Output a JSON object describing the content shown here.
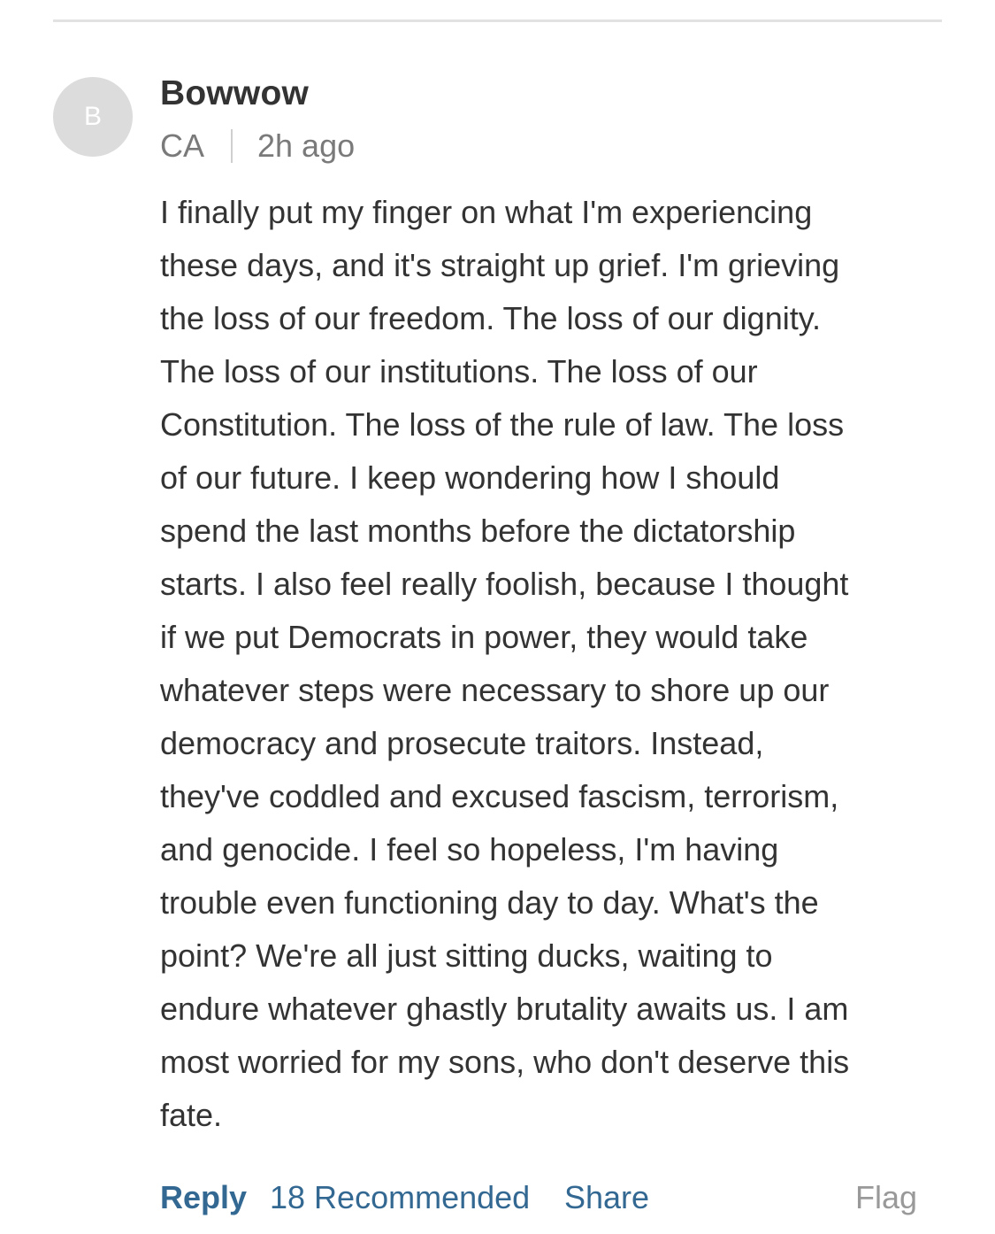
{
  "comment": {
    "avatar_initial": "B",
    "author": "Bowwow",
    "location": "CA",
    "time": "2h ago",
    "body_lines": [
      "I finally put my finger on what I'm experiencing",
      "these days, and it's straight up grief. I'm grieving",
      "the loss of our freedom. The loss of our dignity.",
      "The loss of our institutions. The loss of our",
      "Constitution. The loss of the rule of law. The loss",
      "of our future. I keep wondering how I should",
      "spend the last months before the dictatorship",
      "starts. I also feel really foolish, because I thought",
      "if we put Democrats in power, they would take",
      "whatever steps were necessary to shore up our",
      "democracy and prosecute traitors. Instead,",
      "they've coddled and excused fascism, terrorism,",
      "and genocide. I feel so hopeless, I'm having",
      "trouble even functioning day to day. What's the",
      "point? We're all just sitting ducks, waiting to",
      "endure whatever ghastly brutality awaits us. I am",
      "most worried for my sons, who don't deserve this",
      "fate."
    ]
  },
  "actions": {
    "reply": "Reply",
    "recommended": "18 Recommended",
    "share": "Share",
    "flag": "Flag"
  },
  "colors": {
    "link": "#326891",
    "muted": "#999999",
    "text": "#333333"
  }
}
